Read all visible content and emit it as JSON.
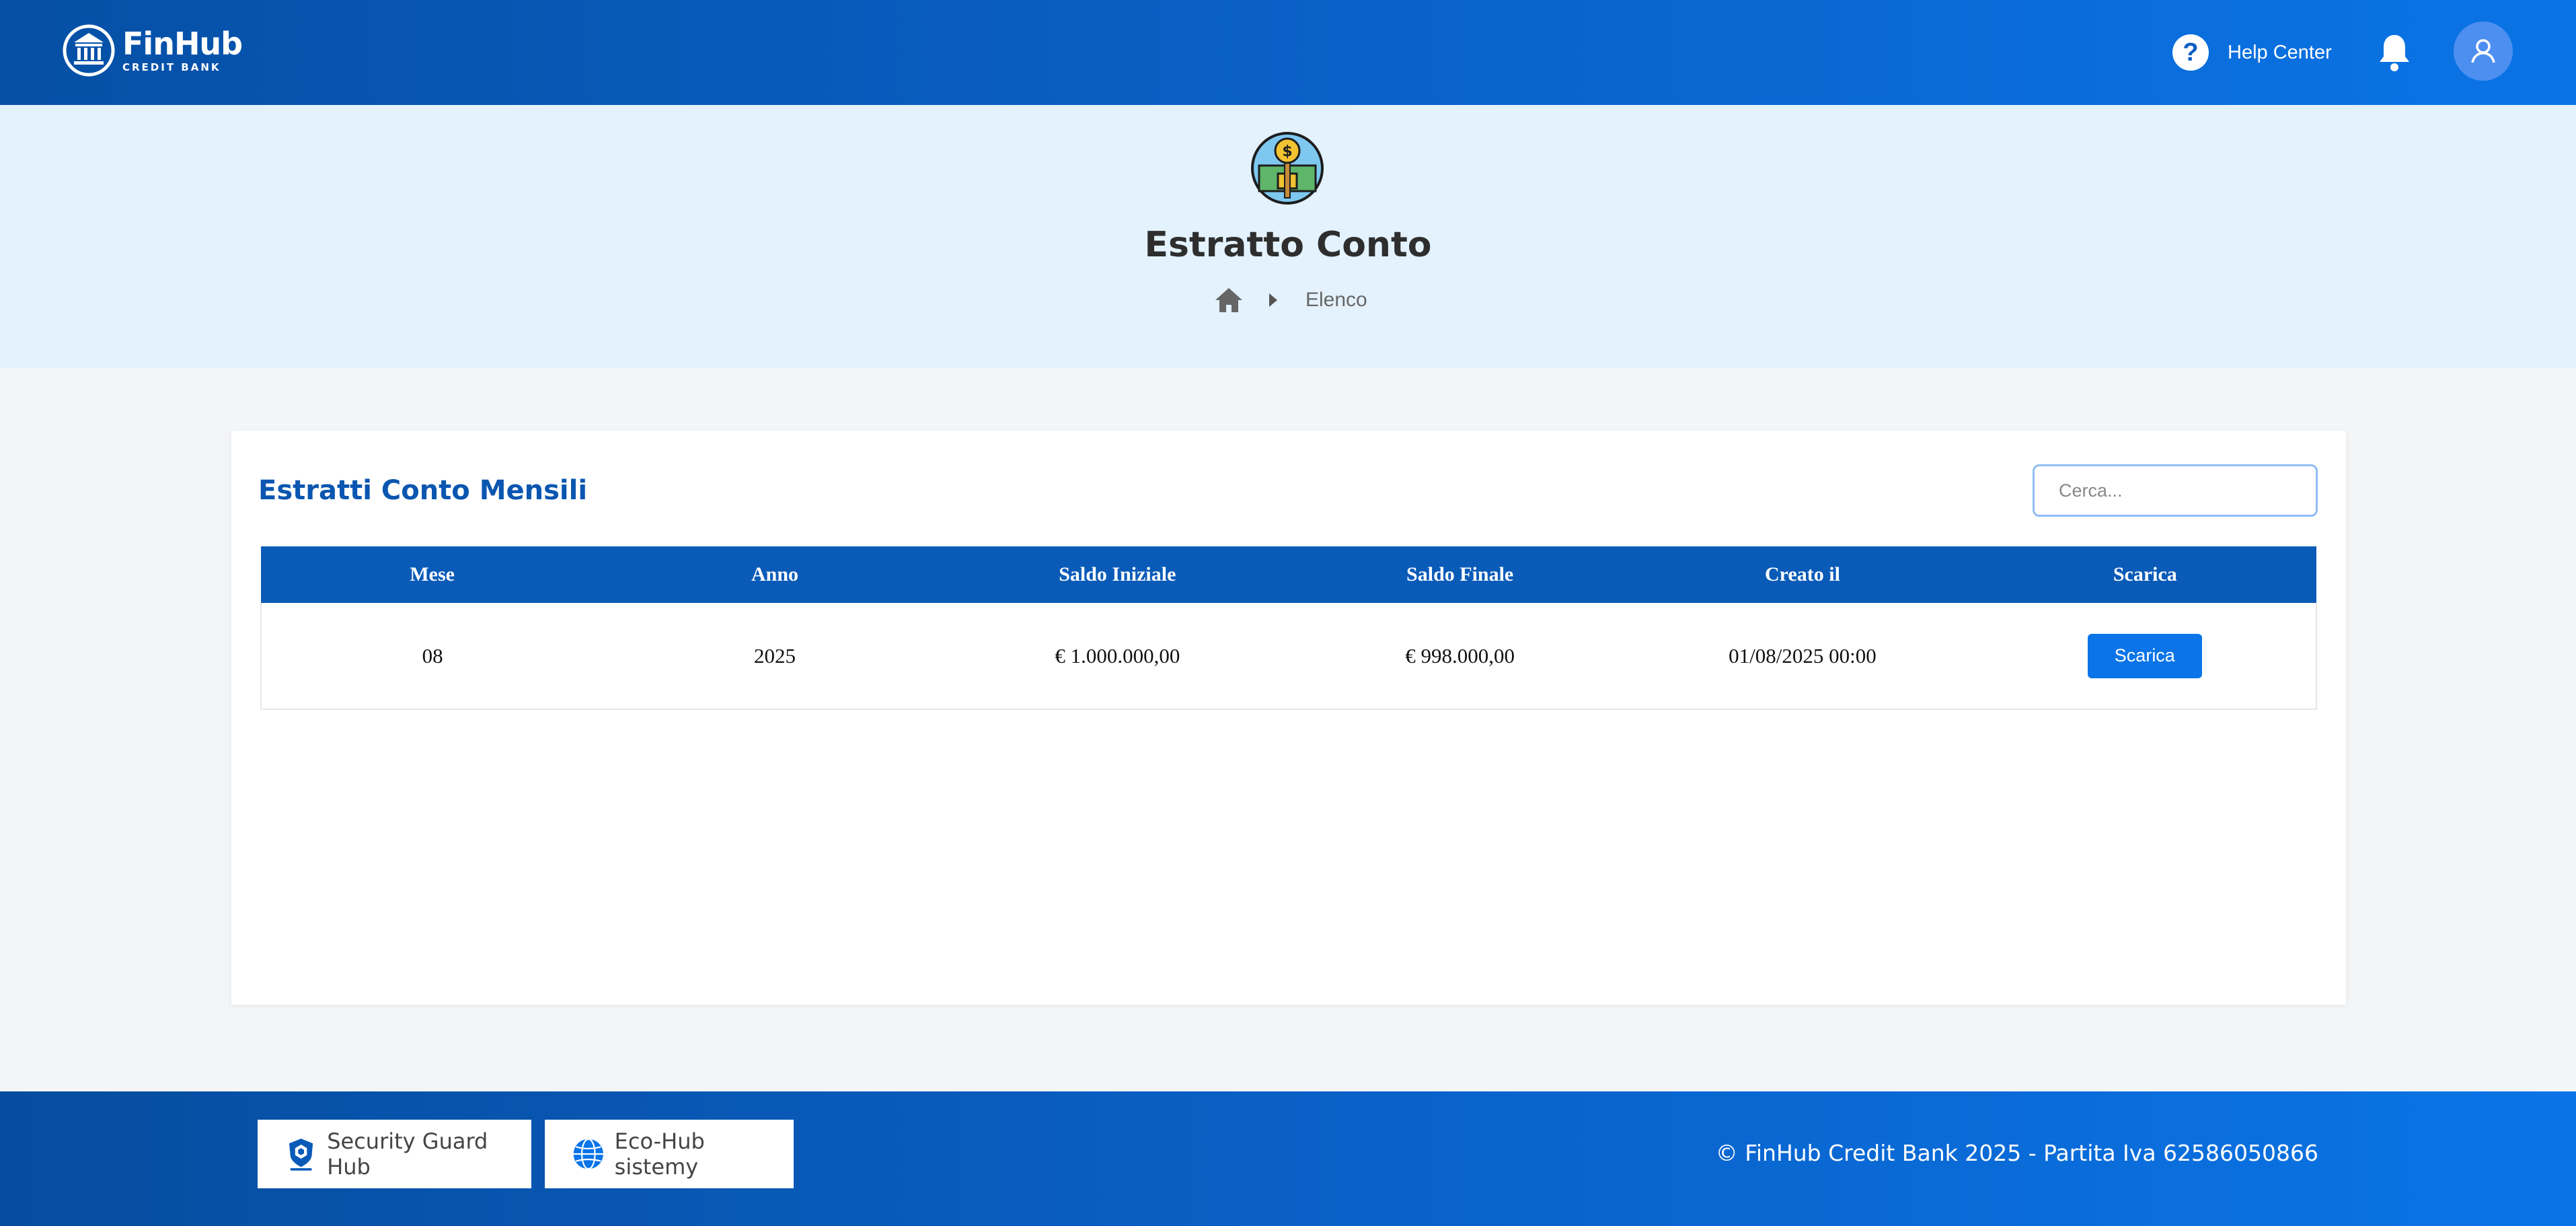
{
  "header": {
    "brand_name": "FinHub",
    "brand_sub": "CREDIT BANK",
    "help_label": "Help Center",
    "help_icon": "question-circle-icon",
    "bell_icon": "bell-icon",
    "avatar_icon": "user-icon"
  },
  "hero": {
    "title": "Estratto Conto",
    "icon": "money-statement-icon",
    "breadcrumb": {
      "home_icon": "home-icon",
      "current": "Elenco"
    }
  },
  "card": {
    "title": "Estratti Conto Mensili",
    "search_placeholder": "Cerca...",
    "table": {
      "headers": [
        "Mese",
        "Anno",
        "Saldo Iniziale",
        "Saldo Finale",
        "Creato il",
        "Scarica"
      ],
      "rows": [
        {
          "mese": "08",
          "anno": "2025",
          "saldo_iniziale": "€ 1.000.000,00",
          "saldo_finale": "€ 998.000,00",
          "creato_il": "01/08/2025 00:00",
          "action": "Scarica"
        }
      ]
    }
  },
  "footer": {
    "links": [
      {
        "label": "Security Guard Hub",
        "icon": "shield-logo-icon"
      },
      {
        "label": "Eco-Hub sistemy",
        "icon": "globe-icon"
      }
    ],
    "copyright": "© FinHub Credit Bank 2025 - Partita Iva 62586050866"
  },
  "colors": {
    "header_start": "#0650a6",
    "header_end": "#0a74e6",
    "hero_bg": "#e3f2fd",
    "table_header": "#0a5bb8",
    "button": "#0a74e8",
    "title_blue": "#0a56b0"
  }
}
